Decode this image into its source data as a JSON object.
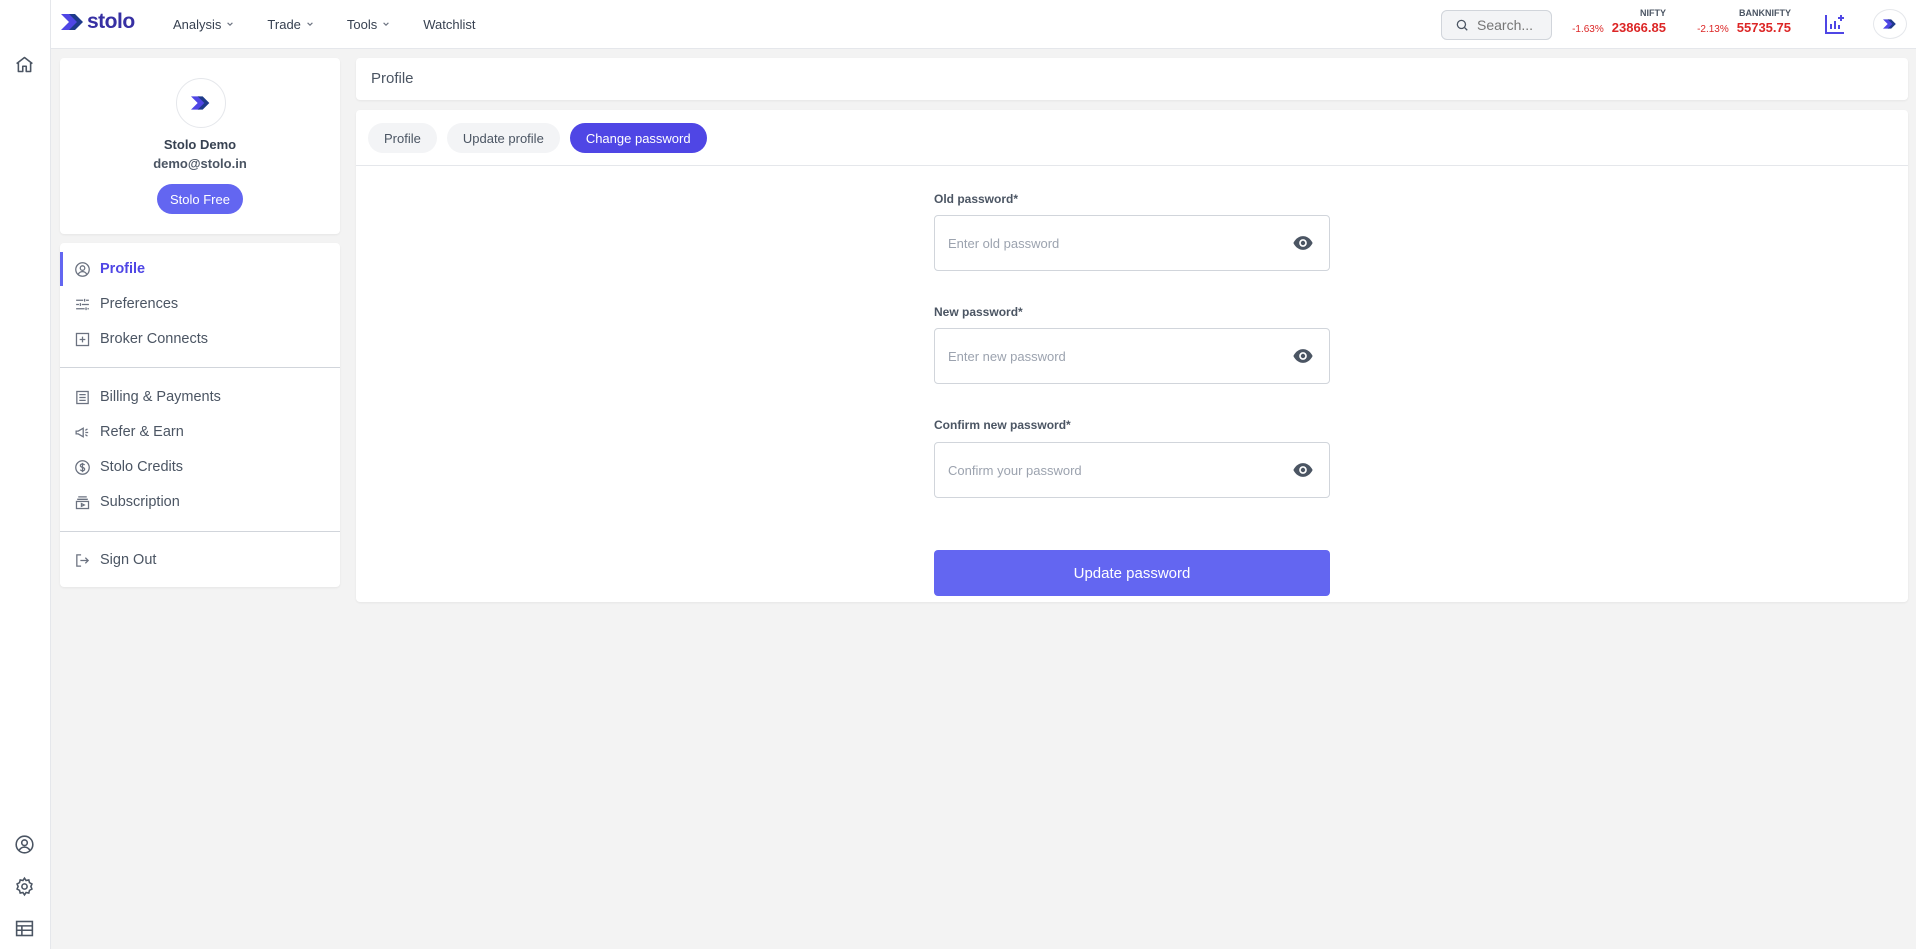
{
  "app": {
    "logo_text": "stolo"
  },
  "nav": {
    "items": [
      {
        "label": "Analysis",
        "has_dropdown": true
      },
      {
        "label": "Trade",
        "has_dropdown": true
      },
      {
        "label": "Tools",
        "has_dropdown": true
      },
      {
        "label": "Watchlist",
        "has_dropdown": false
      }
    ]
  },
  "search": {
    "placeholder": "Search..."
  },
  "tickers": [
    {
      "name": "NIFTY",
      "change": "-1.63%",
      "value": "23866.85"
    },
    {
      "name": "BANKNIFTY",
      "change": "-2.13%",
      "value": "55735.75"
    }
  ],
  "rail": {
    "top_icons": [
      "home-icon"
    ],
    "bottom_icons": [
      "user-circle-icon",
      "gear-icon",
      "layout-icon"
    ]
  },
  "profile": {
    "name": "Stolo Demo",
    "email": "demo@stolo.in",
    "plan": "Stolo Free"
  },
  "menu": {
    "group1": [
      {
        "label": "Profile",
        "icon": "user-circle-icon",
        "active": true
      },
      {
        "label": "Preferences",
        "icon": "sliders-icon",
        "active": false
      },
      {
        "label": "Broker Connects",
        "icon": "plus-square-icon",
        "active": false
      }
    ],
    "group2": [
      {
        "label": "Billing & Payments",
        "icon": "receipt-icon",
        "active": false
      },
      {
        "label": "Refer & Earn",
        "icon": "megaphone-icon",
        "active": false
      },
      {
        "label": "Stolo Credits",
        "icon": "dollar-circle-icon",
        "active": false
      },
      {
        "label": "Subscription",
        "icon": "subscription-icon",
        "active": false
      }
    ],
    "group3": [
      {
        "label": "Sign Out",
        "icon": "logout-icon",
        "active": false
      }
    ]
  },
  "breadcrumb": "Profile",
  "tabs": [
    {
      "label": "Profile",
      "active": false
    },
    {
      "label": "Update profile",
      "active": false
    },
    {
      "label": "Change password",
      "active": true
    }
  ],
  "form": {
    "old_password": {
      "label": "Old password*",
      "placeholder": "Enter old password",
      "value": ""
    },
    "new_password": {
      "label": "New password*",
      "placeholder": "Enter new password",
      "value": ""
    },
    "confirm_password": {
      "label": "Confirm new password*",
      "placeholder": "Confirm your password",
      "value": ""
    },
    "submit_label": "Update password"
  },
  "colors": {
    "accent": "#6366f1",
    "accent_dark": "#4f46e5",
    "negative": "#dc2626",
    "background": "#f3f3f3"
  }
}
